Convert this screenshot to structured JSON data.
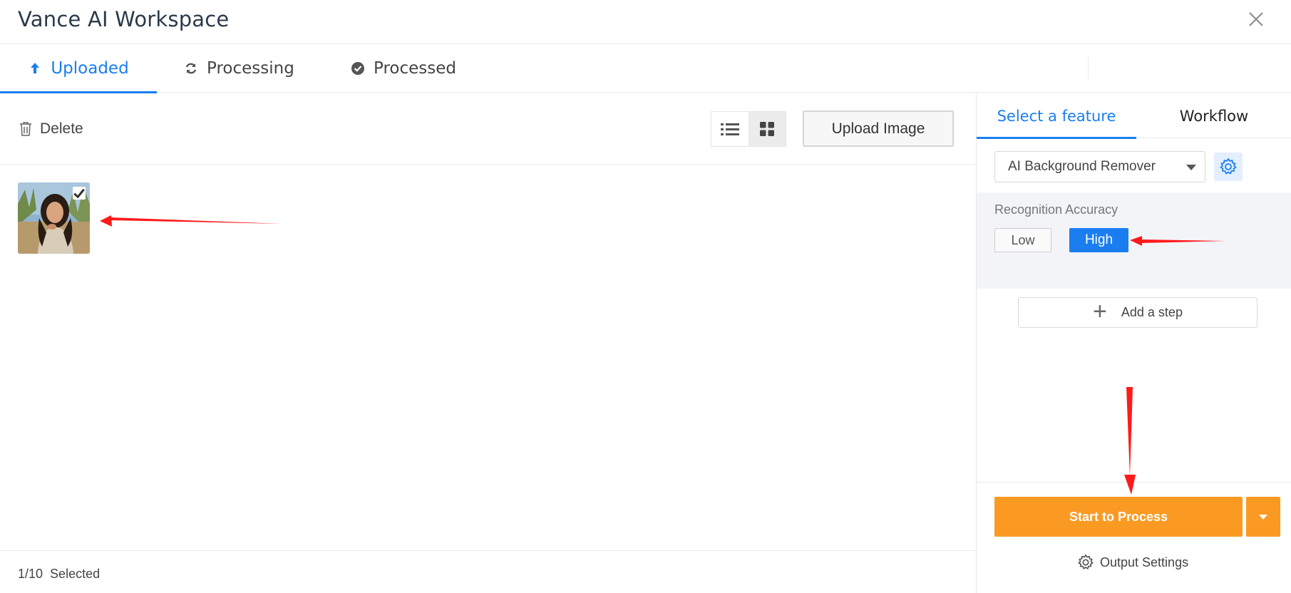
{
  "window": {
    "title": "Vance AI Workspace"
  },
  "tabs": [
    {
      "label": "Uploaded",
      "icon": "upload-arrow-icon",
      "active": true
    },
    {
      "label": "Processing",
      "icon": "refresh-icon",
      "active": false
    },
    {
      "label": "Processed",
      "icon": "check-circle-icon",
      "active": false
    }
  ],
  "toolbar": {
    "delete_label": "Delete",
    "upload_label": "Upload Image",
    "view": "grid"
  },
  "images": [
    {
      "selected": true
    }
  ],
  "footer": {
    "count": "1/10",
    "selected_label": "Selected"
  },
  "panel": {
    "tabs": [
      {
        "label": "Select a feature",
        "active": true
      },
      {
        "label": "Workflow",
        "active": false
      }
    ],
    "feature_value": "AI Background Remover",
    "accuracy_label": "Recognition Accuracy",
    "accuracy_options": [
      "Low",
      "High"
    ],
    "accuracy_selected": "High",
    "add_step_label": "Add a step",
    "start_label": "Start to Process",
    "output_settings_label": "Output Settings"
  },
  "colors": {
    "accent": "#1a7ef0",
    "start_button": "#fb9a23",
    "annotation": "#ff1a1a"
  }
}
